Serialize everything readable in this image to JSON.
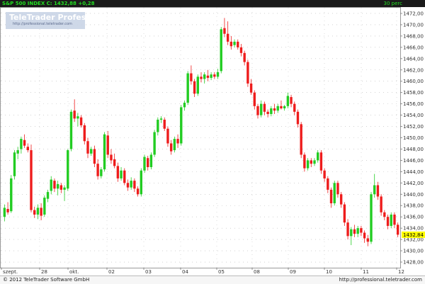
{
  "header": {
    "instrument": "S&P 500 INDEX",
    "quote": "C: 1432,88",
    "change": "+0,28",
    "interval": "30 perc"
  },
  "logo": {
    "title": "TeleTrader Professional",
    "url": "http://professional.teletrader.com"
  },
  "footer": {
    "copyright": "© 2012 TeleTrader Software GmbH",
    "url": "http://professional.teletrader.com"
  },
  "colors": {
    "up": "#22cc22",
    "down": "#ee1c1c",
    "last_price_bg": "#ffff00",
    "header_bg": "#1a1a1a",
    "header_text": "#22dd22"
  },
  "chart_data": {
    "type": "candlestick",
    "ylim": [
      1427,
      1473
    ],
    "y_ticks": [
      "1428,00",
      "1430,00",
      "1432,00",
      "1434,00",
      "1436,00",
      "1438,00",
      "1440,00",
      "1442,00",
      "1444,00",
      "1446,00",
      "1448,00",
      "1450,00",
      "1452,00",
      "1454,00",
      "1456,00",
      "1458,00",
      "1460,00",
      "1462,00",
      "1464,00",
      "1466,00",
      "1468,00",
      "1470,00",
      "1472,00"
    ],
    "x_labels": [
      "szept.",
      "28",
      "okt.",
      "02",
      "03",
      "04",
      "05",
      "08",
      "09",
      "10",
      "11",
      "12"
    ],
    "last_price": "1432,84",
    "grid": true,
    "candles": [
      {
        "o": 1436.0,
        "h": 1438.2,
        "l": 1435.2,
        "c": 1437.6
      },
      {
        "o": 1437.4,
        "h": 1438.6,
        "l": 1436.4,
        "c": 1436.8
      },
      {
        "o": 1437.0,
        "h": 1443.4,
        "l": 1436.7,
        "c": 1442.8
      },
      {
        "o": 1443.2,
        "h": 1447.8,
        "l": 1442.6,
        "c": 1447.4
      },
      {
        "o": 1447.2,
        "h": 1448.4,
        "l": 1446.2,
        "c": 1447.8
      },
      {
        "o": 1448.0,
        "h": 1450.2,
        "l": 1447.2,
        "c": 1449.8
      },
      {
        "o": 1449.6,
        "h": 1450.6,
        "l": 1448.2,
        "c": 1448.6
      },
      {
        "o": 1448.4,
        "h": 1449.0,
        "l": 1447.4,
        "c": 1447.8
      },
      {
        "o": 1447.8,
        "h": 1448.8,
        "l": 1436.8,
        "c": 1437.2
      },
      {
        "o": 1437.2,
        "h": 1437.8,
        "l": 1435.8,
        "c": 1436.4
      },
      {
        "o": 1436.4,
        "h": 1438.2,
        "l": 1435.6,
        "c": 1437.6
      },
      {
        "o": 1437.6,
        "h": 1438.4,
        "l": 1435.4,
        "c": 1436.2
      },
      {
        "o": 1436.4,
        "h": 1439.8,
        "l": 1436.0,
        "c": 1439.4
      },
      {
        "o": 1439.2,
        "h": 1440.8,
        "l": 1438.6,
        "c": 1440.4
      },
      {
        "o": 1440.6,
        "h": 1443.2,
        "l": 1440.0,
        "c": 1442.6
      },
      {
        "o": 1442.4,
        "h": 1442.8,
        "l": 1440.4,
        "c": 1441.0
      },
      {
        "o": 1441.0,
        "h": 1442.4,
        "l": 1439.8,
        "c": 1441.8
      },
      {
        "o": 1441.6,
        "h": 1442.0,
        "l": 1440.2,
        "c": 1440.8
      },
      {
        "o": 1440.8,
        "h": 1441.6,
        "l": 1438.8,
        "c": 1441.2
      },
      {
        "o": 1441.0,
        "h": 1448.0,
        "l": 1440.6,
        "c": 1447.8
      },
      {
        "o": 1448.0,
        "h": 1455.0,
        "l": 1447.6,
        "c": 1454.6
      },
      {
        "o": 1454.8,
        "h": 1456.8,
        "l": 1452.8,
        "c": 1453.4
      },
      {
        "o": 1453.4,
        "h": 1454.4,
        "l": 1452.0,
        "c": 1453.8
      },
      {
        "o": 1453.6,
        "h": 1454.0,
        "l": 1451.8,
        "c": 1452.2
      },
      {
        "o": 1452.2,
        "h": 1452.6,
        "l": 1448.8,
        "c": 1449.4
      },
      {
        "o": 1449.4,
        "h": 1450.0,
        "l": 1446.4,
        "c": 1447.2
      },
      {
        "o": 1447.2,
        "h": 1448.4,
        "l": 1446.8,
        "c": 1448.0
      },
      {
        "o": 1448.0,
        "h": 1448.6,
        "l": 1444.8,
        "c": 1445.4
      },
      {
        "o": 1445.4,
        "h": 1446.2,
        "l": 1442.6,
        "c": 1443.2
      },
      {
        "o": 1443.2,
        "h": 1444.8,
        "l": 1442.8,
        "c": 1444.4
      },
      {
        "o": 1444.4,
        "h": 1451.0,
        "l": 1444.0,
        "c": 1450.6
      },
      {
        "o": 1450.4,
        "h": 1451.2,
        "l": 1446.4,
        "c": 1447.0
      },
      {
        "o": 1447.0,
        "h": 1448.0,
        "l": 1445.4,
        "c": 1446.0
      },
      {
        "o": 1446.2,
        "h": 1447.2,
        "l": 1444.6,
        "c": 1445.0
      },
      {
        "o": 1445.0,
        "h": 1445.6,
        "l": 1442.2,
        "c": 1442.8
      },
      {
        "o": 1442.8,
        "h": 1444.8,
        "l": 1442.4,
        "c": 1444.2
      },
      {
        "o": 1444.2,
        "h": 1444.6,
        "l": 1441.6,
        "c": 1442.0
      },
      {
        "o": 1442.0,
        "h": 1442.6,
        "l": 1440.6,
        "c": 1441.2
      },
      {
        "o": 1441.2,
        "h": 1443.0,
        "l": 1440.8,
        "c": 1442.4
      },
      {
        "o": 1442.4,
        "h": 1442.8,
        "l": 1440.4,
        "c": 1441.0
      },
      {
        "o": 1441.0,
        "h": 1441.4,
        "l": 1439.6,
        "c": 1440.0
      },
      {
        "o": 1440.0,
        "h": 1444.6,
        "l": 1439.6,
        "c": 1444.2
      },
      {
        "o": 1444.2,
        "h": 1447.0,
        "l": 1443.8,
        "c": 1446.6
      },
      {
        "o": 1446.4,
        "h": 1446.8,
        "l": 1444.2,
        "c": 1444.8
      },
      {
        "o": 1444.8,
        "h": 1447.4,
        "l": 1444.4,
        "c": 1447.0
      },
      {
        "o": 1447.0,
        "h": 1451.4,
        "l": 1446.6,
        "c": 1451.0
      },
      {
        "o": 1451.0,
        "h": 1453.6,
        "l": 1450.4,
        "c": 1453.2
      },
      {
        "o": 1453.2,
        "h": 1453.8,
        "l": 1452.6,
        "c": 1453.4
      },
      {
        "o": 1453.2,
        "h": 1453.6,
        "l": 1451.2,
        "c": 1451.6
      },
      {
        "o": 1451.6,
        "h": 1452.0,
        "l": 1448.4,
        "c": 1449.0
      },
      {
        "o": 1449.0,
        "h": 1449.6,
        "l": 1447.0,
        "c": 1447.6
      },
      {
        "o": 1447.8,
        "h": 1450.2,
        "l": 1447.4,
        "c": 1449.8
      },
      {
        "o": 1449.8,
        "h": 1450.6,
        "l": 1448.2,
        "c": 1449.0
      },
      {
        "o": 1449.0,
        "h": 1455.8,
        "l": 1448.6,
        "c": 1455.4
      },
      {
        "o": 1455.4,
        "h": 1456.6,
        "l": 1454.8,
        "c": 1456.2
      },
      {
        "o": 1456.2,
        "h": 1461.8,
        "l": 1455.8,
        "c": 1461.4
      },
      {
        "o": 1461.4,
        "h": 1462.8,
        "l": 1459.4,
        "c": 1460.0
      },
      {
        "o": 1460.0,
        "h": 1460.4,
        "l": 1457.2,
        "c": 1457.8
      },
      {
        "o": 1457.8,
        "h": 1461.2,
        "l": 1457.4,
        "c": 1460.8
      },
      {
        "o": 1460.8,
        "h": 1461.6,
        "l": 1459.8,
        "c": 1460.4
      },
      {
        "o": 1460.4,
        "h": 1461.6,
        "l": 1459.6,
        "c": 1461.2
      },
      {
        "o": 1461.0,
        "h": 1462.0,
        "l": 1460.0,
        "c": 1460.6
      },
      {
        "o": 1460.6,
        "h": 1461.6,
        "l": 1460.2,
        "c": 1461.2
      },
      {
        "o": 1461.2,
        "h": 1461.6,
        "l": 1460.4,
        "c": 1460.8
      },
      {
        "o": 1460.8,
        "h": 1462.2,
        "l": 1460.4,
        "c": 1461.6
      },
      {
        "o": 1461.8,
        "h": 1469.6,
        "l": 1461.4,
        "c": 1469.2
      },
      {
        "o": 1469.4,
        "h": 1471.2,
        "l": 1467.8,
        "c": 1468.4
      },
      {
        "o": 1468.4,
        "h": 1470.6,
        "l": 1466.4,
        "c": 1467.0
      },
      {
        "o": 1467.0,
        "h": 1468.0,
        "l": 1465.6,
        "c": 1466.2
      },
      {
        "o": 1466.4,
        "h": 1467.4,
        "l": 1466.0,
        "c": 1467.0
      },
      {
        "o": 1467.0,
        "h": 1467.4,
        "l": 1465.6,
        "c": 1466.0
      },
      {
        "o": 1466.0,
        "h": 1466.6,
        "l": 1464.4,
        "c": 1465.0
      },
      {
        "o": 1465.0,
        "h": 1465.4,
        "l": 1462.8,
        "c": 1463.4
      },
      {
        "o": 1463.4,
        "h": 1463.8,
        "l": 1459.0,
        "c": 1459.6
      },
      {
        "o": 1459.6,
        "h": 1460.4,
        "l": 1457.6,
        "c": 1458.0
      },
      {
        "o": 1458.0,
        "h": 1458.4,
        "l": 1455.0,
        "c": 1455.6
      },
      {
        "o": 1455.6,
        "h": 1456.0,
        "l": 1453.4,
        "c": 1454.0
      },
      {
        "o": 1454.0,
        "h": 1456.6,
        "l": 1453.6,
        "c": 1456.0
      },
      {
        "o": 1456.0,
        "h": 1456.4,
        "l": 1454.0,
        "c": 1454.6
      },
      {
        "o": 1454.6,
        "h": 1455.0,
        "l": 1453.6,
        "c": 1454.2
      },
      {
        "o": 1454.2,
        "h": 1455.6,
        "l": 1453.8,
        "c": 1455.2
      },
      {
        "o": 1455.2,
        "h": 1456.0,
        "l": 1454.2,
        "c": 1454.8
      },
      {
        "o": 1454.8,
        "h": 1456.0,
        "l": 1454.4,
        "c": 1455.6
      },
      {
        "o": 1455.6,
        "h": 1456.6,
        "l": 1455.0,
        "c": 1455.2
      },
      {
        "o": 1455.2,
        "h": 1455.8,
        "l": 1454.8,
        "c": 1455.6
      },
      {
        "o": 1455.6,
        "h": 1458.0,
        "l": 1455.2,
        "c": 1457.4
      },
      {
        "o": 1457.2,
        "h": 1457.6,
        "l": 1455.4,
        "c": 1456.0
      },
      {
        "o": 1456.0,
        "h": 1456.4,
        "l": 1454.0,
        "c": 1454.6
      },
      {
        "o": 1454.6,
        "h": 1455.0,
        "l": 1451.8,
        "c": 1452.4
      },
      {
        "o": 1452.4,
        "h": 1452.8,
        "l": 1446.4,
        "c": 1447.0
      },
      {
        "o": 1447.0,
        "h": 1447.4,
        "l": 1444.0,
        "c": 1444.6
      },
      {
        "o": 1444.6,
        "h": 1446.4,
        "l": 1444.2,
        "c": 1446.0
      },
      {
        "o": 1446.0,
        "h": 1446.4,
        "l": 1444.8,
        "c": 1445.4
      },
      {
        "o": 1445.4,
        "h": 1446.4,
        "l": 1445.0,
        "c": 1446.0
      },
      {
        "o": 1446.0,
        "h": 1447.8,
        "l": 1445.6,
        "c": 1447.4
      },
      {
        "o": 1447.4,
        "h": 1447.8,
        "l": 1443.6,
        "c": 1444.2
      },
      {
        "o": 1444.2,
        "h": 1444.6,
        "l": 1442.2,
        "c": 1442.8
      },
      {
        "o": 1442.8,
        "h": 1443.2,
        "l": 1440.2,
        "c": 1440.8
      },
      {
        "o": 1440.8,
        "h": 1441.2,
        "l": 1437.6,
        "c": 1438.4
      },
      {
        "o": 1438.4,
        "h": 1442.4,
        "l": 1438.0,
        "c": 1442.0
      },
      {
        "o": 1442.0,
        "h": 1442.4,
        "l": 1439.4,
        "c": 1440.0
      },
      {
        "o": 1440.0,
        "h": 1440.4,
        "l": 1437.6,
        "c": 1438.2
      },
      {
        "o": 1438.2,
        "h": 1438.6,
        "l": 1434.4,
        "c": 1435.0
      },
      {
        "o": 1435.0,
        "h": 1435.6,
        "l": 1432.0,
        "c": 1432.6
      },
      {
        "o": 1432.6,
        "h": 1434.2,
        "l": 1431.0,
        "c": 1433.8
      },
      {
        "o": 1433.8,
        "h": 1434.6,
        "l": 1432.4,
        "c": 1433.0
      },
      {
        "o": 1433.0,
        "h": 1434.4,
        "l": 1432.4,
        "c": 1434.0
      },
      {
        "o": 1434.0,
        "h": 1434.4,
        "l": 1432.6,
        "c": 1433.2
      },
      {
        "o": 1433.2,
        "h": 1433.6,
        "l": 1431.4,
        "c": 1432.2
      },
      {
        "o": 1432.2,
        "h": 1432.8,
        "l": 1430.8,
        "c": 1431.6
      },
      {
        "o": 1431.6,
        "h": 1440.4,
        "l": 1431.2,
        "c": 1440.0
      },
      {
        "o": 1440.0,
        "h": 1443.6,
        "l": 1439.4,
        "c": 1441.6
      },
      {
        "o": 1441.6,
        "h": 1442.2,
        "l": 1439.0,
        "c": 1439.6
      },
      {
        "o": 1439.6,
        "h": 1440.0,
        "l": 1436.2,
        "c": 1436.8
      },
      {
        "o": 1436.8,
        "h": 1437.2,
        "l": 1435.4,
        "c": 1436.0
      },
      {
        "o": 1436.0,
        "h": 1436.4,
        "l": 1433.8,
        "c": 1434.4
      },
      {
        "o": 1434.4,
        "h": 1436.8,
        "l": 1434.0,
        "c": 1436.4
      },
      {
        "o": 1436.4,
        "h": 1436.8,
        "l": 1434.0,
        "c": 1434.6
      },
      {
        "o": 1434.6,
        "h": 1435.0,
        "l": 1432.4,
        "c": 1432.84
      }
    ]
  }
}
